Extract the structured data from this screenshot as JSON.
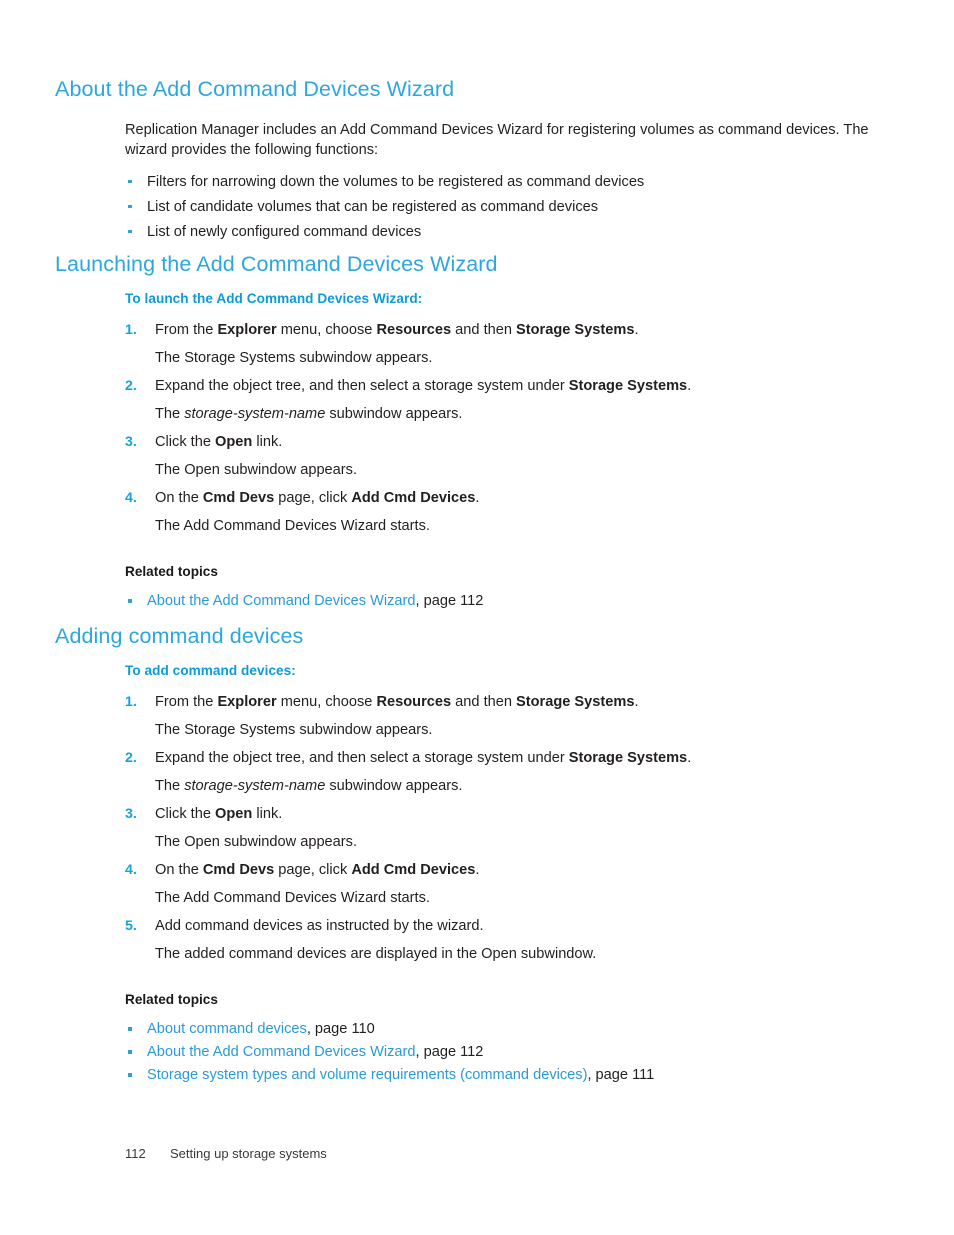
{
  "sections": [
    {
      "heading": "About the Add Command Devices Wizard",
      "paragraph": "Replication Manager includes an Add Command Devices Wizard for registering volumes as command devices. The wizard provides the following functions:",
      "bullets": [
        "Filters for narrowing down the volumes to be registered as command devices",
        "List of candidate volumes that can be registered as command devices",
        "List of newly configured command devices"
      ]
    },
    {
      "heading": "Launching the Add Command Devices Wizard",
      "subheading": "To launch the Add Command Devices Wizard:",
      "steps": [
        {
          "num": "1.",
          "parts": [
            {
              "t": "From the ",
              "s": "n"
            },
            {
              "t": "Explorer",
              "s": "b"
            },
            {
              "t": " menu, choose ",
              "s": "n"
            },
            {
              "t": "Resources",
              "s": "b"
            },
            {
              "t": " and then ",
              "s": "n"
            },
            {
              "t": "Storage Systems",
              "s": "b"
            },
            {
              "t": ".",
              "s": "n"
            }
          ],
          "result": [
            {
              "t": "The Storage Systems subwindow appears.",
              "s": "n"
            }
          ]
        },
        {
          "num": "2.",
          "parts": [
            {
              "t": "Expand the object tree, and then select a storage system under ",
              "s": "n"
            },
            {
              "t": "Storage Systems",
              "s": "b"
            },
            {
              "t": ".",
              "s": "n"
            }
          ],
          "result": [
            {
              "t": "The ",
              "s": "n"
            },
            {
              "t": "storage-system-name",
              "s": "i"
            },
            {
              "t": " subwindow appears.",
              "s": "n"
            }
          ]
        },
        {
          "num": "3.",
          "parts": [
            {
              "t": "Click the ",
              "s": "n"
            },
            {
              "t": "Open",
              "s": "b"
            },
            {
              "t": " link.",
              "s": "n"
            }
          ],
          "result": [
            {
              "t": "The Open subwindow appears.",
              "s": "n"
            }
          ]
        },
        {
          "num": "4.",
          "parts": [
            {
              "t": "On the ",
              "s": "n"
            },
            {
              "t": "Cmd Devs",
              "s": "b"
            },
            {
              "t": " page, click ",
              "s": "n"
            },
            {
              "t": "Add Cmd Devices",
              "s": "b"
            },
            {
              "t": ".",
              "s": "n"
            }
          ],
          "result": [
            {
              "t": "The Add Command Devices Wizard starts.",
              "s": "n"
            }
          ]
        }
      ],
      "related_heading": "Related topics",
      "related": [
        {
          "link": "About the Add Command Devices Wizard",
          "suffix": ", page 112"
        }
      ]
    },
    {
      "heading": "Adding command devices",
      "subheading": "To add command devices:",
      "steps": [
        {
          "num": "1.",
          "parts": [
            {
              "t": "From the ",
              "s": "n"
            },
            {
              "t": "Explorer",
              "s": "b"
            },
            {
              "t": " menu, choose ",
              "s": "n"
            },
            {
              "t": "Resources",
              "s": "b"
            },
            {
              "t": " and then ",
              "s": "n"
            },
            {
              "t": "Storage Systems",
              "s": "b"
            },
            {
              "t": ".",
              "s": "n"
            }
          ],
          "result": [
            {
              "t": "The Storage Systems subwindow appears.",
              "s": "n"
            }
          ]
        },
        {
          "num": "2.",
          "parts": [
            {
              "t": "Expand the object tree, and then select a storage system under ",
              "s": "n"
            },
            {
              "t": "Storage Systems",
              "s": "b"
            },
            {
              "t": ".",
              "s": "n"
            }
          ],
          "result": [
            {
              "t": "The ",
              "s": "n"
            },
            {
              "t": "storage-system-name",
              "s": "i"
            },
            {
              "t": " subwindow appears.",
              "s": "n"
            }
          ]
        },
        {
          "num": "3.",
          "parts": [
            {
              "t": "Click the ",
              "s": "n"
            },
            {
              "t": "Open",
              "s": "b"
            },
            {
              "t": " link.",
              "s": "n"
            }
          ],
          "result": [
            {
              "t": "The Open subwindow appears.",
              "s": "n"
            }
          ]
        },
        {
          "num": "4.",
          "parts": [
            {
              "t": "On the ",
              "s": "n"
            },
            {
              "t": "Cmd Devs",
              "s": "b"
            },
            {
              "t": " page, click ",
              "s": "n"
            },
            {
              "t": "Add Cmd Devices",
              "s": "b"
            },
            {
              "t": ".",
              "s": "n"
            }
          ],
          "result": [
            {
              "t": "The Add Command Devices Wizard starts.",
              "s": "n"
            }
          ]
        },
        {
          "num": "5.",
          "parts": [
            {
              "t": "Add command devices as instructed by the wizard.",
              "s": "n"
            }
          ],
          "result": [
            {
              "t": "The added command devices are displayed in the Open subwindow.",
              "s": "n"
            }
          ]
        }
      ],
      "related_heading": "Related topics",
      "related": [
        {
          "link": "About command devices",
          "suffix": ", page 110"
        },
        {
          "link": "About the Add Command Devices Wizard",
          "suffix": ", page 112"
        },
        {
          "link": "Storage system types and volume requirements (command devices)",
          "suffix": ", page 111"
        }
      ]
    }
  ],
  "footer": {
    "page_number": "112",
    "chapter": "Setting up storage systems"
  },
  "colors": {
    "heading_blue": "#2ba7de",
    "subheading_blue": "#0e9bd8",
    "step_number_blue": "#14a3dd",
    "link_blue": "#2a9ad7",
    "bullet_blue": "#2f9fd6",
    "body_text": "#231f20"
  }
}
